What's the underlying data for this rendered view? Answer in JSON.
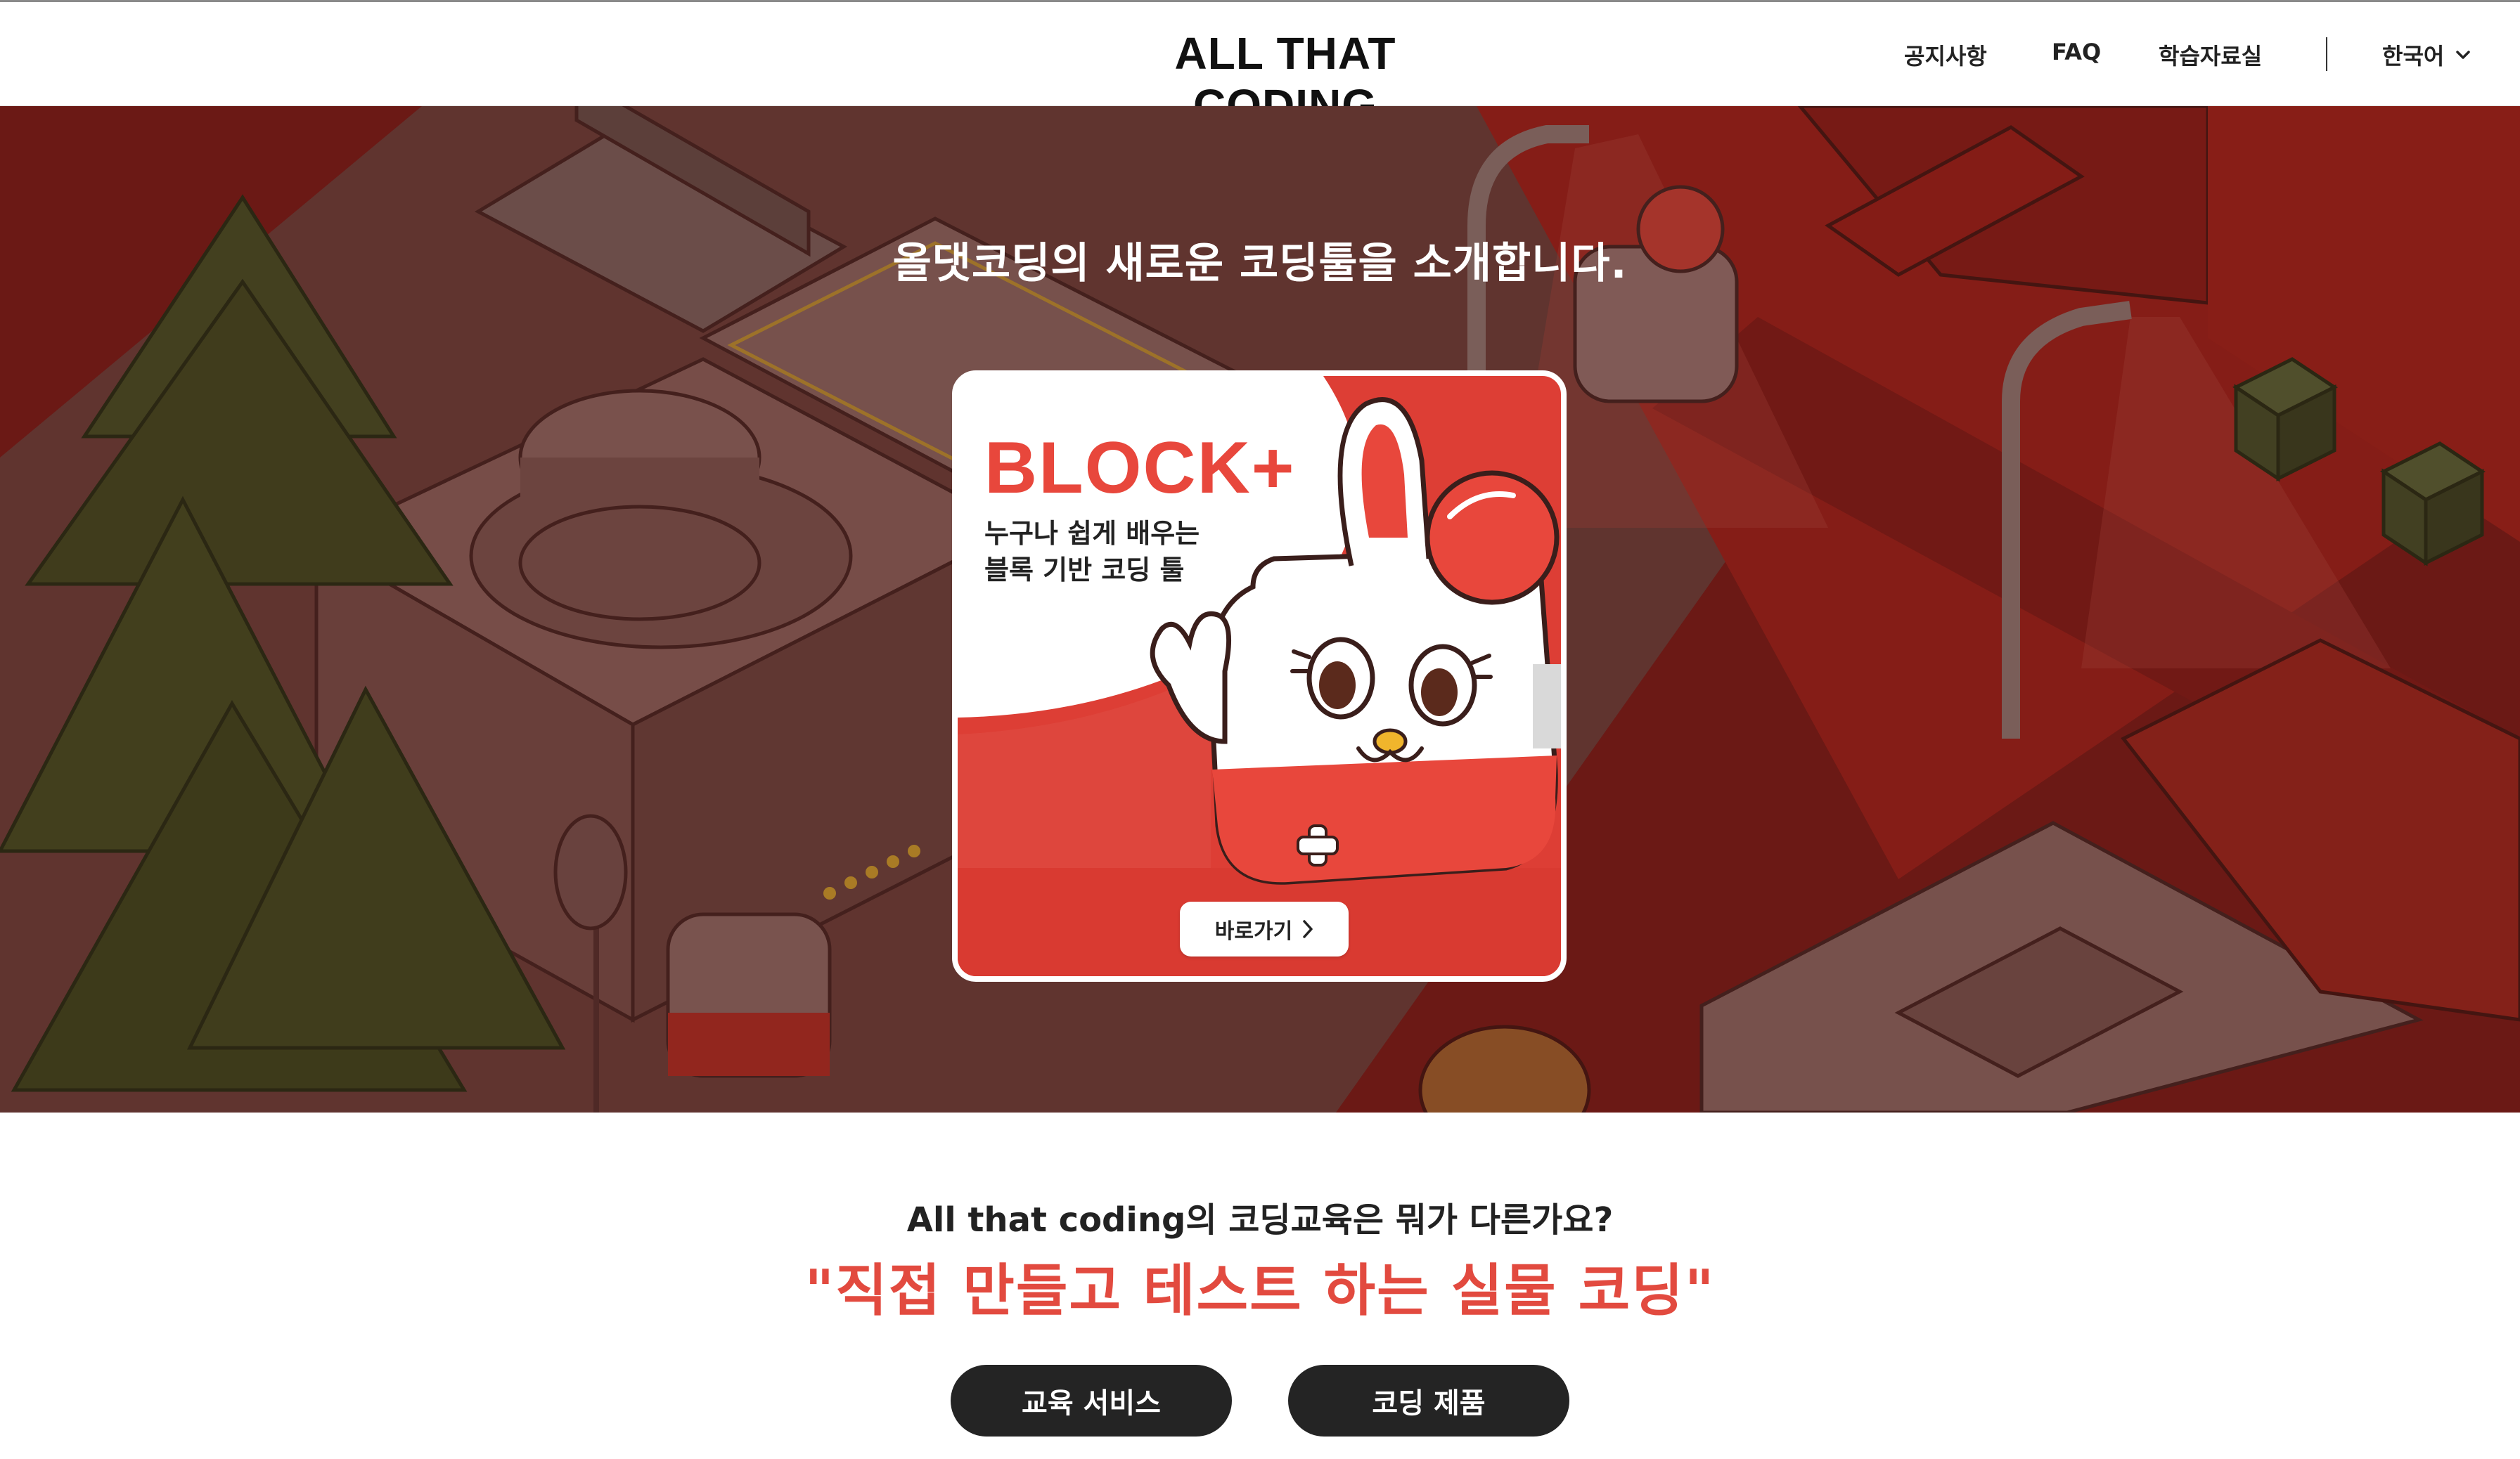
{
  "header": {
    "logo": "ALL THAT CODING",
    "nav": [
      "공지사항",
      "FAQ",
      "학습자료실"
    ],
    "language": "한국어"
  },
  "hero": {
    "title": "올댓코딩의 새로운 코딩툴을 소개합니다.",
    "card": {
      "title": "BLOCK+",
      "subtitle_line1": "누구나 쉽게 배우는",
      "subtitle_line2": "블록 기반 코딩 툴",
      "button": "바로가기"
    }
  },
  "intro": {
    "question": "All that coding의 코딩교육은 뭐가 다른가요?",
    "slogan": "\"직접 만들고 테스트 하는 실물 코딩\""
  },
  "buttons": {
    "education": "교육 서비스",
    "products": "코딩 제품"
  },
  "colors": {
    "accent": "#e8473c",
    "hero_overlay": "#7a1a17",
    "dark_button": "#242424"
  },
  "icons": [
    "chevron-down-icon",
    "chevron-right-icon"
  ]
}
